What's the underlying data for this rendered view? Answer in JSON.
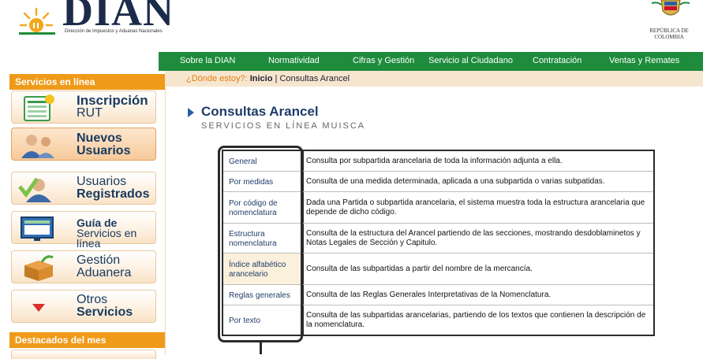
{
  "header": {
    "logo_word": "DIAN",
    "logo_sub": "Dirección de Impuestos y Aduanas Nacionales",
    "coa_line1": "REPÚBLICA DE",
    "coa_line2": "COLOMBIA"
  },
  "topnav": [
    {
      "label": "Sobre la DIAN"
    },
    {
      "label": "Normatividad"
    },
    {
      "label": "Cifras y Gestión"
    },
    {
      "label": "Servicio al Ciudadano"
    },
    {
      "label": "Contratación"
    },
    {
      "label": "Ventas y Remates"
    }
  ],
  "sidebar": {
    "head1": "Servicios en línea",
    "head2": "Destacados del mes",
    "items": [
      {
        "line1": "Inscripción",
        "line2": "RUT",
        "icon": "rut-form-icon"
      },
      {
        "line1": "Nuevos",
        "line2": "Usuarios",
        "icon": "new-users-icon"
      },
      {
        "line1": "Usuarios",
        "line2": "Registrados",
        "icon": "registered-user-icon"
      },
      {
        "line1": "Guía de",
        "line2": "Servicios en línea",
        "icon": "screen-guide-icon"
      },
      {
        "line1": "Gestión",
        "line2": "Aduanera",
        "icon": "customs-box-icon"
      },
      {
        "line1": "Otros",
        "line2": "Servicios",
        "icon": "chevron-down-icon"
      }
    ]
  },
  "breadcrumb": {
    "question": "¿Dónde estoy?:",
    "home": "Inicio",
    "separator": "|",
    "current": "Consultas Arancel"
  },
  "main": {
    "title": "Consultas Arancel",
    "subtitle": "SERVICIOS EN LÍNEA MUISCA"
  },
  "table": [
    {
      "label": "General",
      "desc": "Consulta por subpartida arancelaria de toda la información adjunta a ella."
    },
    {
      "label": "Por medidas",
      "desc": "Consulta de una medida determinada, aplicada a una subpartida o varias subpatidas."
    },
    {
      "label": "Por código de nomenclatura",
      "desc": "Dada una Partida o subpartida arancelaria, el sistema muestra toda la estructura arancelaria que depende de dicho código."
    },
    {
      "label": "Estructura nomenclatura",
      "desc": "Consulta de la estructura del Arancel partiendo de las secciones, mostrando desdoblaminetos y Notas Legales de Sección y Capitulo."
    },
    {
      "label": "Índice alfabético arancelario",
      "desc": "Consulta de las subpartidas a partir del nombre de la mercancía."
    },
    {
      "label": "Reglas generales",
      "desc": "Consulta de las Reglas Generales Interpretativas de la Nomenclatura."
    },
    {
      "label": "Por texto",
      "desc": "Consulta de las subpartidas arancelarias, partiendo de los textos que contienen la descripción de la nomenclatura."
    }
  ],
  "colors": {
    "nav_green": "#1e8c3c",
    "sidebar_orange": "#f09a1a",
    "breadcrumb_bg": "#f7e6cf",
    "title_blue": "#1e3d6a"
  }
}
